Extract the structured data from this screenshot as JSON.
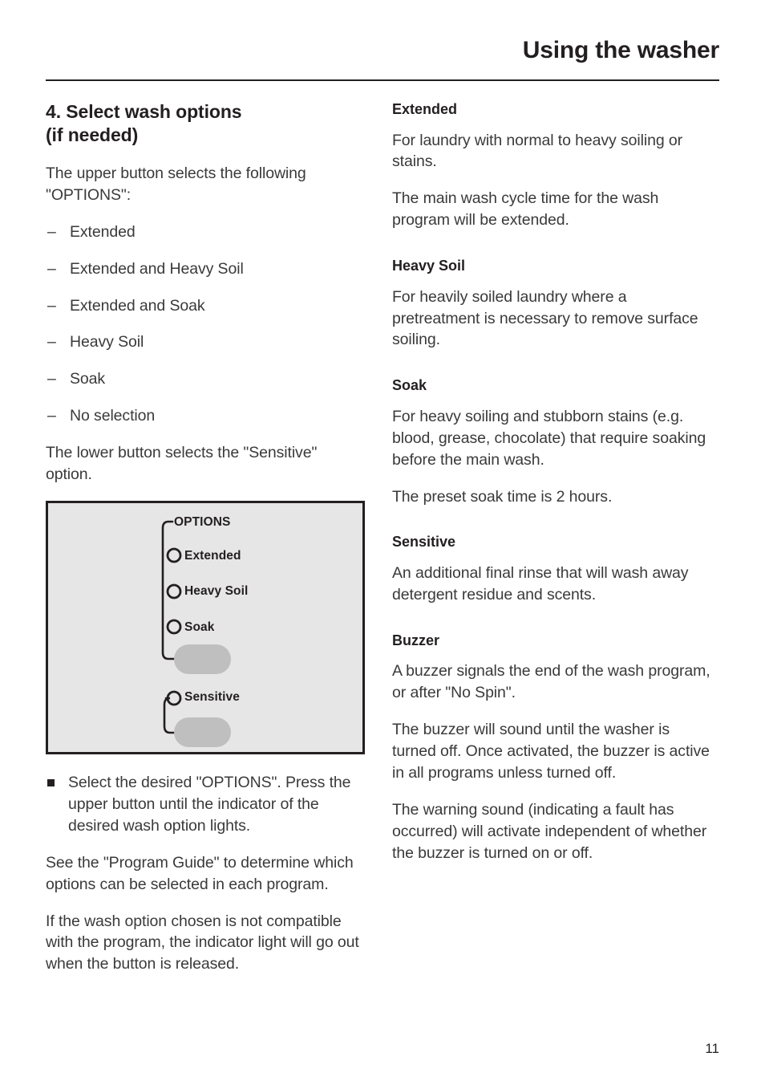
{
  "header": {
    "title": "Using the washer"
  },
  "left_column": {
    "section_title": "4. Select wash options\n(if needed)",
    "intro": "The upper button selects the following \"OPTIONS\":",
    "options_list": [
      "Extended",
      "Extended and Heavy Soil",
      "Extended and Soak",
      "Heavy Soil",
      "Soak",
      "No selection"
    ],
    "dash_marker": "–",
    "lower_button_text": "The lower button selects the \"Sensitive\" option.",
    "instruction": "Select the desired \"OPTIONS\". Press the upper button until the indicator of the desired wash option lights.",
    "program_guide": "See the \"Program Guide\" to determine which options can be selected in each program.",
    "incompatible": "If the wash option chosen is not compatible with the program, the indicator light will go out when the button is released."
  },
  "figure": {
    "bracket_label": "OPTIONS",
    "indicators": [
      "Extended",
      "Heavy Soil",
      "Soak"
    ],
    "sensitive_label": "Sensitive",
    "colors": {
      "panel_background": "#e6e6e6",
      "panel_border": "#231f20",
      "button_fill": "#bfbfbf",
      "line": "#231f20"
    }
  },
  "right_column": {
    "sections": [
      {
        "heading": "Extended",
        "paragraphs": [
          "For laundry with normal to heavy soiling or stains.",
          "The main wash cycle time for the wash program will be extended."
        ]
      },
      {
        "heading": "Heavy Soil",
        "paragraphs": [
          "For heavily soiled laundry where a pretreatment is necessary to remove surface soiling."
        ]
      },
      {
        "heading": "Soak",
        "paragraphs": [
          "For heavy soiling and stubborn stains (e.g. blood, grease, chocolate) that require soaking before the main wash.",
          "The preset soak time is 2 hours."
        ]
      },
      {
        "heading": "Sensitive",
        "paragraphs": [
          "An additional final rinse that will wash away detergent residue and scents."
        ]
      },
      {
        "heading": "Buzzer",
        "paragraphs": [
          "A buzzer signals the end of the wash program, or after \"No Spin\".",
          "The buzzer will sound until the washer is turned off. Once activated, the buzzer is active in all programs unless turned off.",
          "The warning sound (indicating a fault has occurred) will activate independent of whether the buzzer is turned on or off."
        ]
      }
    ]
  },
  "footer": {
    "page_number": "11"
  }
}
